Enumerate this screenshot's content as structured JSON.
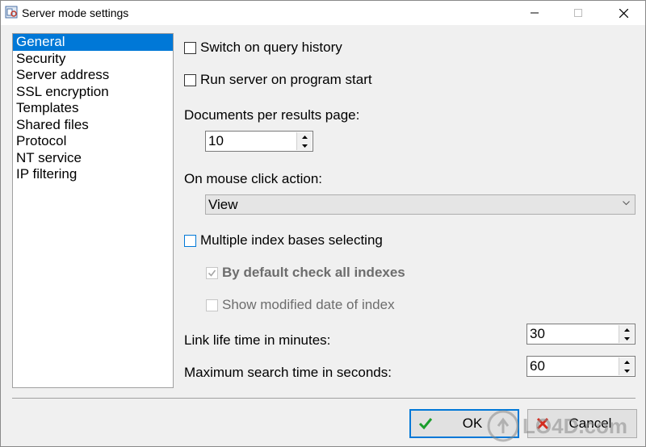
{
  "window": {
    "title": "Server mode settings"
  },
  "tree": {
    "items": [
      "General",
      "Security",
      "Server address",
      "SSL encryption",
      "Templates",
      "Shared files",
      "Protocol",
      "NT service",
      "IP filtering"
    ],
    "selected_index": 0
  },
  "general": {
    "query_history_label": "Switch on query history",
    "query_history_checked": false,
    "run_on_start_label": "Run server on program start",
    "run_on_start_checked": false,
    "docs_per_page_label": "Documents per results page:",
    "docs_per_page_value": "10",
    "mouse_click_label": "On mouse click action:",
    "mouse_click_value": "View",
    "multiple_index_label": "Multiple index bases selecting",
    "multiple_index_checked": false,
    "check_all_label": "By default check all indexes",
    "check_all_checked": true,
    "show_modified_label": "Show modified date of index",
    "show_modified_checked": false,
    "link_life_label": "Link life time in minutes:",
    "link_life_value": "30",
    "max_search_label": "Maximum search time in seconds:",
    "max_search_value": "60"
  },
  "buttons": {
    "ok_label": "OK",
    "cancel_label": "Cancel"
  },
  "colors": {
    "accent": "#0078d7",
    "ok_check": "#1a9e2c",
    "cancel_x": "#d42b1e"
  },
  "watermark": {
    "text": "LO4D.com"
  }
}
